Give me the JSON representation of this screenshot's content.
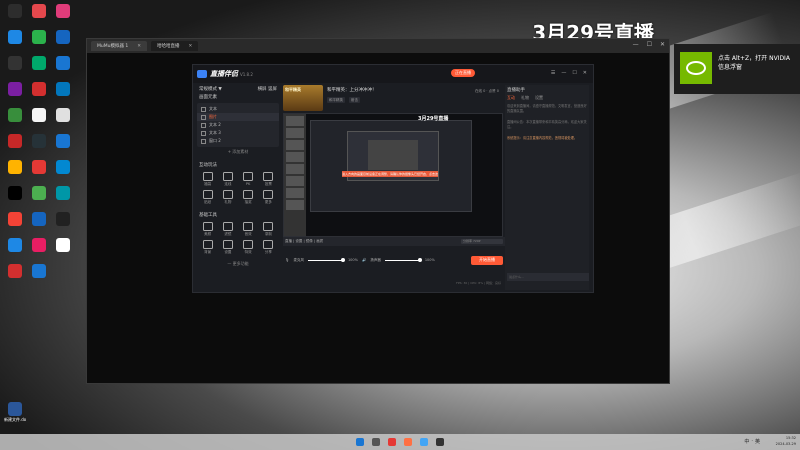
{
  "desktop": {
    "icons": [
      {
        "label": "",
        "color": "#2d2d2d"
      },
      {
        "label": "",
        "color": "#e5484d"
      },
      {
        "label": "",
        "color": "#e03c7a"
      },
      {
        "label": "",
        "color": "#1e88e5"
      },
      {
        "label": "",
        "color": "#2bb24c"
      },
      {
        "label": "",
        "color": "#1565c0"
      },
      {
        "label": "",
        "color": "#333"
      },
      {
        "label": "",
        "color": "#00a86b"
      },
      {
        "label": "",
        "color": "#1976d2"
      },
      {
        "label": "",
        "color": "#7b1fa2"
      },
      {
        "label": "",
        "color": "#d32f2f"
      },
      {
        "label": "",
        "color": "#0277bd"
      },
      {
        "label": "",
        "color": "#388e3c"
      },
      {
        "label": "",
        "color": "#f5f5f5"
      },
      {
        "label": "",
        "color": "#e0e0e0"
      },
      {
        "label": "",
        "color": "#c62828"
      },
      {
        "label": "",
        "color": "#263238"
      },
      {
        "label": "",
        "color": "#1976d2"
      },
      {
        "label": "",
        "color": "#ffb300"
      },
      {
        "label": "",
        "color": "#e53935"
      },
      {
        "label": "",
        "color": "#0288d1"
      },
      {
        "label": "",
        "color": "#000"
      },
      {
        "label": "",
        "color": "#4caf50"
      },
      {
        "label": "",
        "color": "#0097a7"
      },
      {
        "label": "",
        "color": "#f44336"
      },
      {
        "label": "",
        "color": "#1565c0"
      },
      {
        "label": "",
        "color": "#212121"
      },
      {
        "label": "",
        "color": "#1e88e5"
      },
      {
        "label": "",
        "color": "#e91e63"
      },
      {
        "label": "",
        "color": "#ffffff"
      },
      {
        "label": "",
        "color": "#d32f2f"
      },
      {
        "label": "",
        "color": "#1976d2"
      }
    ],
    "file_icon_label": "新建文件.docx"
  },
  "obs": {
    "tabs": [
      {
        "label": "MuMu模拟器 1"
      },
      {
        "label": "哈哈哈直播"
      }
    ]
  },
  "app": {
    "logo": "直播伴侣",
    "version": "V1.8.2",
    "live_tag": "正在直播",
    "top_ctrls": [
      "☰",
      "—",
      "☐",
      "✕"
    ],
    "left": {
      "section1": "常规模式 ▼",
      "section1_actions": "横屏  竖屏",
      "scene_label": "画面元素",
      "sources": [
        {
          "label": "文本",
          "selected": false
        },
        {
          "label": "图片",
          "selected": true
        },
        {
          "label": "文本 2",
          "selected": false
        },
        {
          "label": "文本 3",
          "selected": false
        },
        {
          "label": "窗口 2",
          "selected": false
        }
      ],
      "add_source": "+ 添加素材",
      "interact_title": "互动玩法",
      "interact_tools": [
        "福袋",
        "连线",
        "PK",
        "投票",
        "贴纸",
        "礼物",
        "抽奖",
        "更多"
      ],
      "tools_title": "基础工具",
      "basic_tools": [
        "美颜",
        "滤镜",
        "音效",
        "录制",
        "背景",
        "设置",
        "特效",
        "分享"
      ],
      "more": "— 更多功能"
    },
    "center": {
      "cover_caption": "和平精英",
      "room_title": "和平精英：上分冲冲冲！",
      "tags": [
        "和平精英",
        "射击"
      ],
      "stats": "在线 0  ·  点赞 0",
      "preview_caption": "3月29号直播",
      "warning": "进入方向的画面目前设备正在调整，请确认你的摄像头已经开启，点击这里对其进行调整",
      "scene_bar": "直播  |  设置  |  镜像  |  画质",
      "resolution": "分辨率 720P",
      "mic_label": "麦克风",
      "mic_value": "100%",
      "speaker_label": "扬声器",
      "speaker_value": "100%",
      "go_live": "开始直播",
      "footer": "FPS: 30  |  CPU: 8%  |  网络：良好"
    },
    "right": {
      "title": "直播助手",
      "tabs": [
        {
          "label": "互动",
          "on": true
        },
        {
          "label": "礼物",
          "on": false
        },
        {
          "label": "设置",
          "on": false
        }
      ],
      "text1": "欢迎来到直播间，请遵守直播规范，文明发言，营造良好的直播氛围。",
      "text2": "直播间公告：本次直播带来和平精英高分局，欢迎大家关注。",
      "text_hl": "系统提示：请注意直播内容规范，违规将被处理。",
      "input_ph": "说点什么…"
    }
  },
  "overlay_title": "3月29号直播",
  "corner_badge": "45",
  "notification": {
    "text": "点击 Alt+Z，打开 NVIDIA 信息浮窗"
  },
  "tray": {
    "ime": [
      "中",
      "·",
      "英"
    ],
    "time": "15:32",
    "date": "2024-03-29"
  },
  "colors": {
    "accent": "#ff5a36",
    "nvidia": "#76b900"
  }
}
